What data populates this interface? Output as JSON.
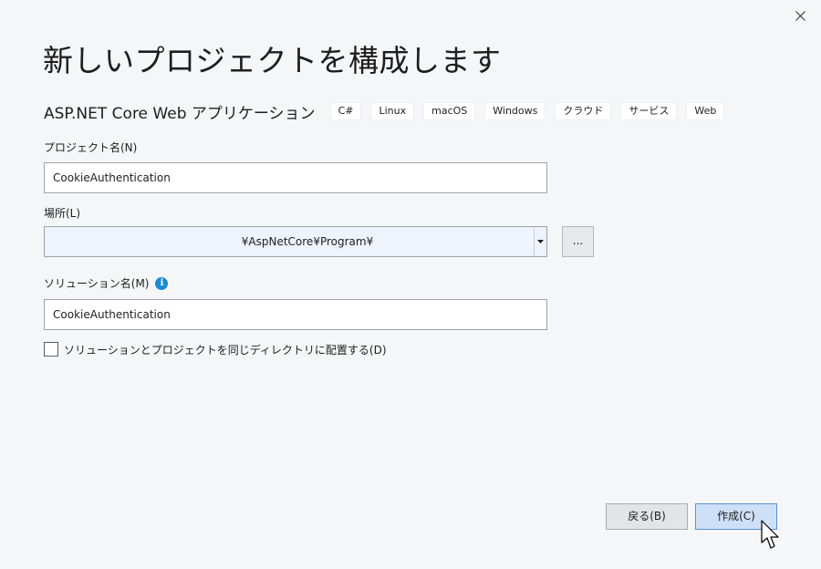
{
  "dialog": {
    "title": "新しいプロジェクトを構成します",
    "close_icon": "close-icon"
  },
  "template": {
    "name": "ASP.NET Core Web アプリケーション",
    "tags": [
      "C#",
      "Linux",
      "macOS",
      "Windows",
      "クラウド",
      "サービス",
      "Web"
    ]
  },
  "project_name": {
    "label": "プロジェクト名(N)",
    "value": "CookieAuthentication"
  },
  "location": {
    "label": "場所(L)",
    "value": "¥AspNetCore¥Program¥",
    "browse_label": "..."
  },
  "solution_name": {
    "label": "ソリューション名(M)",
    "info_icon": "info-icon",
    "info_glyph": "i",
    "value": "CookieAuthentication"
  },
  "same_directory": {
    "label": "ソリューションとプロジェクトを同じディレクトリに配置する(D)",
    "checked": false
  },
  "footer": {
    "back_label": "戻る(B)",
    "create_label": "作成(C)"
  },
  "colors": {
    "background": "#f5f6f8",
    "accent": "#1e88d2",
    "primary_button": "#cde0f7"
  }
}
